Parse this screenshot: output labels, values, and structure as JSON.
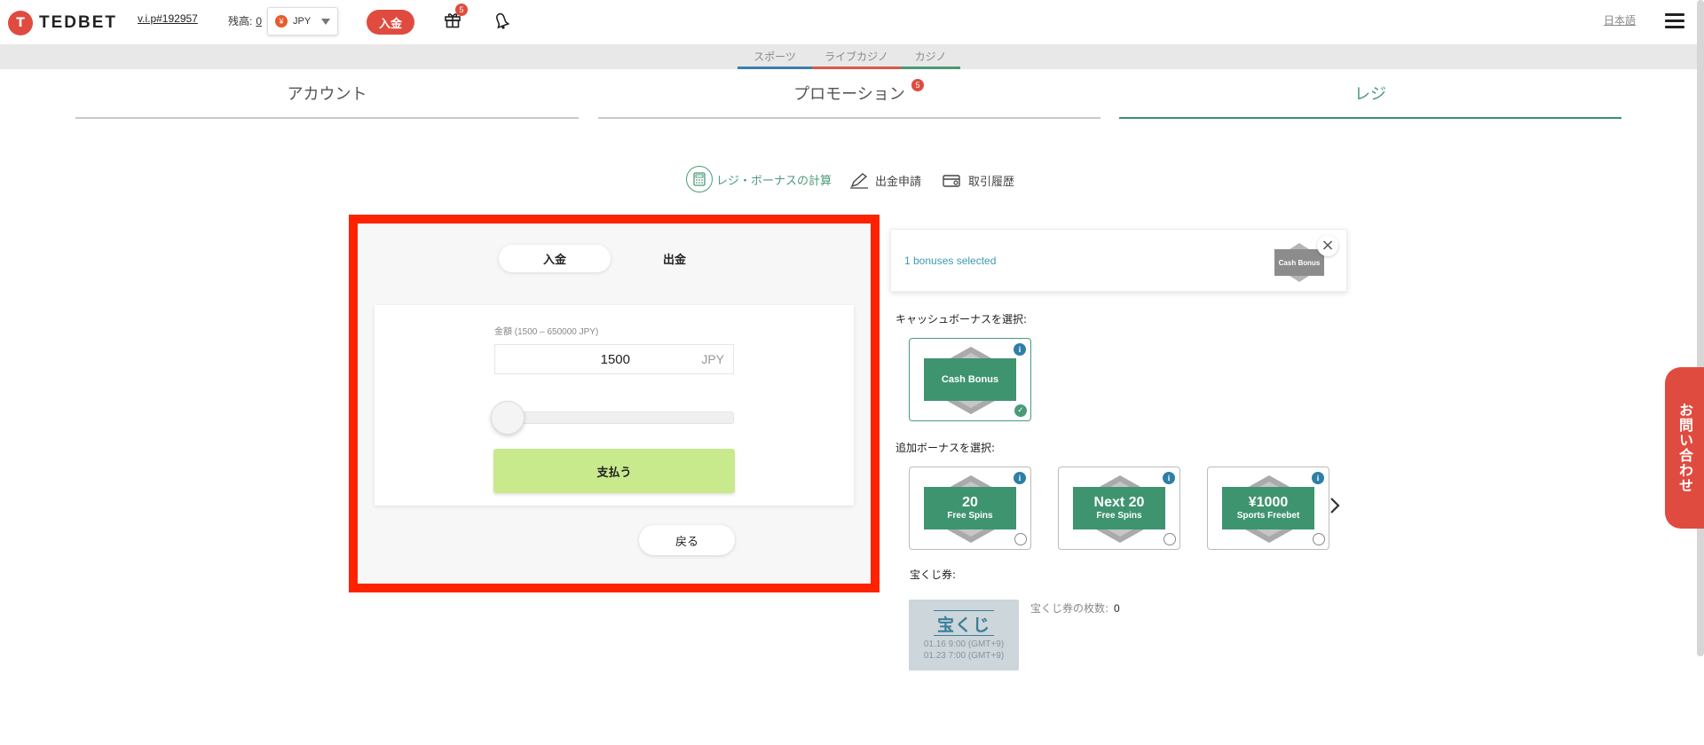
{
  "header": {
    "logo_text": "TEDBET",
    "logo_mark": "T",
    "vip": "v.i.p#192957",
    "balance_label": "残高:",
    "balance_value": "0",
    "currency_symbol": "¥",
    "currency": "JPY",
    "deposit_label": "入金",
    "gift_badge": "5",
    "language": "日本語"
  },
  "subnav": {
    "items": [
      {
        "label": "スポーツ",
        "color": "#3a7fb0"
      },
      {
        "label": "ライブカジノ",
        "color": "#d95a4a"
      },
      {
        "label": "カジノ",
        "color": "#4a9a78"
      }
    ]
  },
  "tabs": {
    "account": "アカウント",
    "promotion": "プロモーション",
    "promotion_badge": "5",
    "cashier": "レジ"
  },
  "subactions": {
    "calculator": "レジ・ボーナスの計算",
    "withdraw_request": "出金申請",
    "history": "取引履歴"
  },
  "payment": {
    "deposit_tab": "入金",
    "withdraw_tab": "出金",
    "amount_label": "金額 (1500 – 650000 JPY)",
    "amount_value": "1500",
    "amount_unit": "JPY",
    "slider_level": 0,
    "pay_button": "支払う",
    "back_button": "戻る"
  },
  "bonus": {
    "selected_text": "1 bonuses selected",
    "selected_thumb": "Cash Bonus",
    "cash_section_label": "キャッシュボーナスを選択:",
    "cash_bonus": {
      "big": "",
      "small": "Cash Bonus",
      "selected": true
    },
    "extra_section_label": "追加ボーナスを選択:",
    "extra_bonuses": [
      {
        "big": "20",
        "small": "Free Spins"
      },
      {
        "big": "Next 20",
        "small": "Free Spins"
      },
      {
        "big": "¥1000",
        "small": "Sports Freebet"
      }
    ],
    "info_glyph": "i"
  },
  "lottery": {
    "section_label": "宝くじ券:",
    "ticket_title": "宝くじ",
    "date_start": "01.16 9:00 (GMT+9)",
    "date_end": "01.23 7:00 (GMT+9)",
    "count_label": "宝くじ券の枚数:",
    "count_value": "0"
  },
  "contact": {
    "label": "お問い合わせ"
  },
  "colors": {
    "brand_red": "#e04b3f",
    "accent_green": "#4a9a78",
    "highlight_frame": "#ff2200",
    "pay_button": "#c8ea8c"
  }
}
